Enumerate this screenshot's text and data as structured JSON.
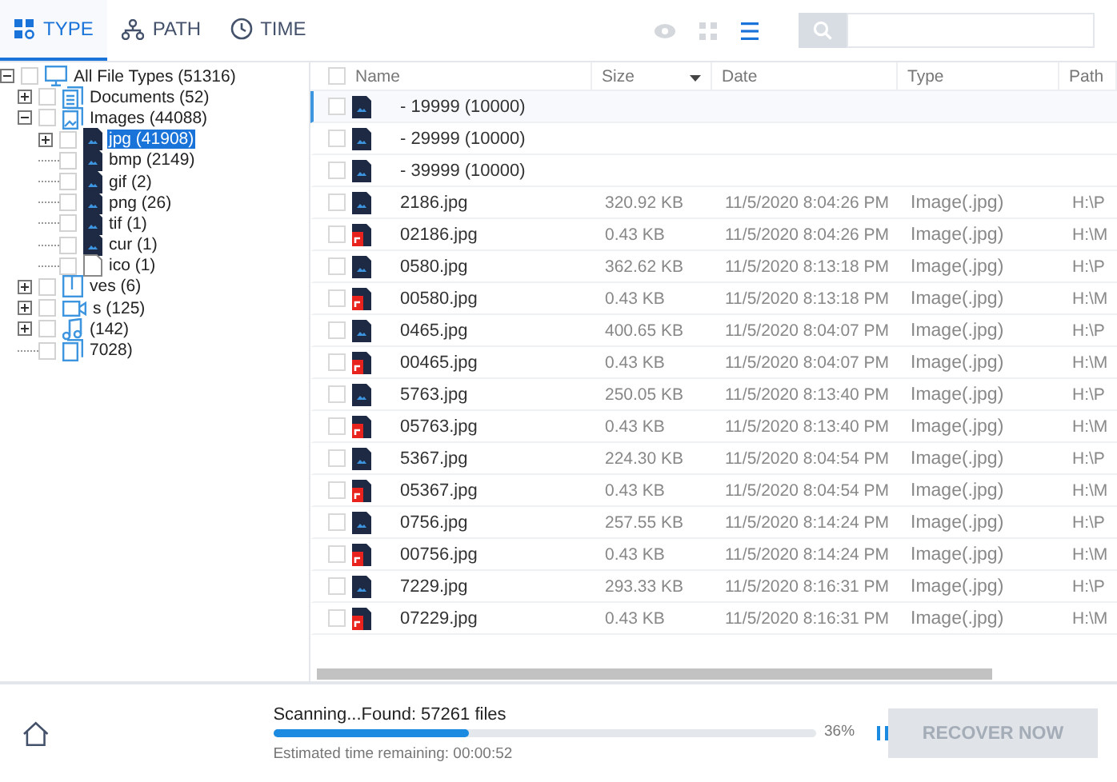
{
  "tabs": [
    {
      "label": "TYPE",
      "kind": "type",
      "selected": true
    },
    {
      "label": "PATH",
      "kind": "path",
      "selected": false
    },
    {
      "label": "TIME",
      "kind": "time",
      "selected": false
    }
  ],
  "views": [
    {
      "kind": "preview",
      "selected": false
    },
    {
      "kind": "grid",
      "selected": false
    },
    {
      "kind": "list",
      "selected": true
    }
  ],
  "tree": [
    {
      "label": "All File Types (51316)",
      "kind": "computer",
      "checked": false,
      "selected": false,
      "expanded": true,
      "children": [
        {
          "label": "Documents (52)",
          "kind": "document",
          "checked": false,
          "selected": false,
          "expanded": false
        },
        {
          "label": "Images (44088)",
          "kind": "images",
          "checked": false,
          "selected": false,
          "expanded": true,
          "children": [
            {
              "label": "jpg (41908)",
              "kind": "image-file",
              "checked": false,
              "selected": true,
              "expanded": false
            },
            {
              "label": "bmp (2149)",
              "kind": "image-file",
              "checked": false,
              "selected": false
            },
            {
              "label": "gif (2)",
              "kind": "image-file",
              "checked": false,
              "selected": false
            },
            {
              "label": "png (26)",
              "kind": "image-file",
              "checked": false,
              "selected": false
            },
            {
              "label": "tif (1)",
              "kind": "image-file",
              "checked": false,
              "selected": false
            },
            {
              "label": "cur (1)",
              "kind": "image-file",
              "checked": false,
              "selected": false
            },
            {
              "label": "ico (1)",
              "kind": "blank-file",
              "checked": false,
              "selected": false
            }
          ]
        },
        {
          "label": "ves (6)",
          "kind": "archive",
          "checked": false,
          "selected": false,
          "expanded": false
        },
        {
          "label": "s (125)",
          "kind": "video",
          "checked": false,
          "selected": false,
          "expanded": false
        },
        {
          "label": "(142)",
          "kind": "audio",
          "checked": false,
          "selected": false,
          "expanded": false
        },
        {
          "label": "7028)",
          "kind": "other",
          "checked": false,
          "selected": false
        }
      ]
    }
  ],
  "table": {
    "select_all": {
      "checked": false
    },
    "columns": [
      {
        "label": "Name",
        "sorted": false
      },
      {
        "label": "Size",
        "sorted": true
      },
      {
        "label": "Date",
        "sorted": false
      },
      {
        "label": "Type",
        "sorted": false
      },
      {
        "label": "Path",
        "sorted": false
      }
    ],
    "rows": [
      {
        "kind": "group",
        "name": "- 19999 (10000)",
        "checked": false,
        "selected": true
      },
      {
        "kind": "group",
        "name": "- 29999 (10000)",
        "checked": false,
        "selected": false
      },
      {
        "kind": "group",
        "name": "- 39999 (10000)",
        "checked": false,
        "selected": false
      },
      {
        "kind": "image",
        "name": "2186.jpg",
        "size": "320.92 KB",
        "date": "11/5/2020 8:04:26 PM",
        "type": "Image(.jpg)",
        "path": "H:\\P",
        "checked": false,
        "selected": false
      },
      {
        "kind": "shortcut",
        "name": "02186.jpg",
        "size": "0.43 KB",
        "date": "11/5/2020 8:04:26 PM",
        "type": "Image(.jpg)",
        "path": "H:\\M",
        "checked": false,
        "selected": false
      },
      {
        "kind": "image",
        "name": "0580.jpg",
        "size": "362.62 KB",
        "date": "11/5/2020 8:13:18 PM",
        "type": "Image(.jpg)",
        "path": "H:\\P",
        "checked": false,
        "selected": false
      },
      {
        "kind": "shortcut",
        "name": "00580.jpg",
        "size": "0.43 KB",
        "date": "11/5/2020 8:13:18 PM",
        "type": "Image(.jpg)",
        "path": "H:\\M",
        "checked": false,
        "selected": false
      },
      {
        "kind": "image",
        "name": "0465.jpg",
        "size": "400.65 KB",
        "date": "11/5/2020 8:04:07 PM",
        "type": "Image(.jpg)",
        "path": "H:\\P",
        "checked": false,
        "selected": false
      },
      {
        "kind": "shortcut",
        "name": "00465.jpg",
        "size": "0.43 KB",
        "date": "11/5/2020 8:04:07 PM",
        "type": "Image(.jpg)",
        "path": "H:\\M",
        "checked": false,
        "selected": false
      },
      {
        "kind": "image",
        "name": "5763.jpg",
        "size": "250.05 KB",
        "date": "11/5/2020 8:13:40 PM",
        "type": "Image(.jpg)",
        "path": "H:\\P",
        "checked": false,
        "selected": false
      },
      {
        "kind": "shortcut",
        "name": "05763.jpg",
        "size": "0.43 KB",
        "date": "11/5/2020 8:13:40 PM",
        "type": "Image(.jpg)",
        "path": "H:\\M",
        "checked": false,
        "selected": false
      },
      {
        "kind": "image",
        "name": "5367.jpg",
        "size": "224.30 KB",
        "date": "11/5/2020 8:04:54 PM",
        "type": "Image(.jpg)",
        "path": "H:\\P",
        "checked": false,
        "selected": false
      },
      {
        "kind": "shortcut",
        "name": "05367.jpg",
        "size": "0.43 KB",
        "date": "11/5/2020 8:04:54 PM",
        "type": "Image(.jpg)",
        "path": "H:\\M",
        "checked": false,
        "selected": false
      },
      {
        "kind": "image",
        "name": "0756.jpg",
        "size": "257.55 KB",
        "date": "11/5/2020 8:14:24 PM",
        "type": "Image(.jpg)",
        "path": "H:\\P",
        "checked": false,
        "selected": false
      },
      {
        "kind": "shortcut",
        "name": "00756.jpg",
        "size": "0.43 KB",
        "date": "11/5/2020 8:14:24 PM",
        "type": "Image(.jpg)",
        "path": "H:\\M",
        "checked": false,
        "selected": false
      },
      {
        "kind": "image",
        "name": "7229.jpg",
        "size": "293.33 KB",
        "date": "11/5/2020 8:16:31 PM",
        "type": "Image(.jpg)",
        "path": "H:\\P",
        "checked": false,
        "selected": false
      },
      {
        "kind": "shortcut",
        "name": "07229.jpg",
        "size": "0.43 KB",
        "date": "11/5/2020 8:16:31 PM",
        "type": "Image(.jpg)",
        "path": "H:\\M",
        "checked": false,
        "selected": false
      }
    ]
  },
  "status": {
    "message": "Scanning...Found: 57261 files",
    "level": 0.36,
    "percent": "36%",
    "estimate": "Estimated time remaining: 00:00:52"
  },
  "recover_button": {
    "label": "RECOVER NOW",
    "disabled": true
  }
}
